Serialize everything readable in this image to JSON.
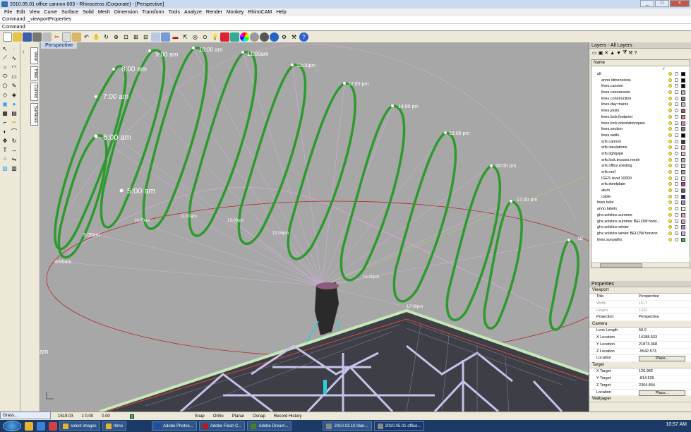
{
  "window": {
    "title": "2010.05.01 office cannon 003 - Rhinoceros (Corporate) - [Perspective]",
    "minimize": "_",
    "maximize": "□",
    "close": "×"
  },
  "menu": [
    "File",
    "Edit",
    "View",
    "Curve",
    "Surface",
    "Solid",
    "Mesh",
    "Dimension",
    "Transform",
    "Tools",
    "Analyze",
    "Render",
    "Monkey",
    "RhinoCAM",
    "Help"
  ],
  "command": {
    "history": "Command: _viewportProperties",
    "prompt": "Command:"
  },
  "viewport": {
    "label": "Perspective"
  },
  "side_tabs": [
    "View",
    "Files",
    "Curves",
    "Surfaces"
  ],
  "sun_labels": [
    "5:00 am",
    "6:00 am",
    "7:00 am",
    "8:00 am",
    "9:00 am",
    "10:00 am",
    "11:00am",
    "12:00pm",
    "12:00 pm",
    "14:00 pm",
    "15:00 pm",
    "16:00 pm",
    "17:00 pm",
    "18",
    "5:00am",
    "6:00am",
    "10:00am",
    "11:00am",
    "12:00pm",
    "13:00pm",
    "16:00pm",
    "17:00pm",
    "am"
  ],
  "layers": {
    "title": "Layers - All Layers",
    "column": "Name",
    "check": "✓",
    "rows": [
      {
        "name": "all",
        "depth": 0,
        "color": "#000000"
      },
      {
        "name": "anno.dimensions",
        "depth": 2,
        "color": "#000000"
      },
      {
        "name": "lines.cannon",
        "depth": 2,
        "color": "#000000"
      },
      {
        "name": "lines.cannonaxis",
        "depth": 2,
        "color": "#9cc39c"
      },
      {
        "name": "lines.construction",
        "depth": 2,
        "color": "#7f7f7f"
      },
      {
        "name": "lines.day marks",
        "depth": 2,
        "color": "#c0c0c0"
      },
      {
        "name": "lines.joists",
        "depth": 2,
        "color": "#a05a5a"
      },
      {
        "name": "lines.lock.footprint",
        "depth": 2,
        "color": "#e08080"
      },
      {
        "name": "lines.lock.orientationques",
        "depth": 2,
        "color": "#d87ad8"
      },
      {
        "name": "lines.section",
        "depth": 2,
        "color": "#808080"
      },
      {
        "name": "lines.walls",
        "depth": 2,
        "color": "#000000"
      },
      {
        "name": "srfs.cannon",
        "depth": 2,
        "color": "#404040"
      },
      {
        "name": "srfs.insulations",
        "depth": 2,
        "color": "#f0a0a0"
      },
      {
        "name": "srfs.lightpipe",
        "depth": 2,
        "color": "#ffc0c0"
      },
      {
        "name": "srfs.lock.trusses.mesh",
        "depth": 2,
        "color": "#c0b0d0"
      },
      {
        "name": "srfs.office.existing",
        "depth": 2,
        "color": "#c8c8c8"
      },
      {
        "name": "srfs.roof",
        "depth": 2,
        "color": "#b0b0b0"
      },
      {
        "name": "IGES level 10000",
        "depth": 2,
        "color": "#e0e0e0"
      },
      {
        "name": "srfs.steelplate",
        "depth": 2,
        "color": "#e020c0"
      },
      {
        "name": "alum",
        "depth": 2,
        "color": "#606060"
      },
      {
        "name": "cable",
        "depth": 2,
        "color": "#2020c0"
      },
      {
        "name": "lines.tube",
        "depth": 0,
        "color": "#9090d0"
      },
      {
        "name": "anno.labels",
        "depth": 0,
        "color": "#ffffff"
      },
      {
        "name": "ghx.solstice.summer",
        "depth": 0,
        "color": "#ffa0c0"
      },
      {
        "name": "ghx.solstice.summer BELOW.horiz...",
        "depth": 0,
        "color": "#e0a0e0"
      },
      {
        "name": "ghx.solstice.winter",
        "depth": 0,
        "color": "#c080ff"
      },
      {
        "name": "ghx.solstice.winter BELOW.horizon",
        "depth": 0,
        "color": "#d0b0ff"
      },
      {
        "name": "lines.sunpaths",
        "depth": 0,
        "color": "#30c030"
      }
    ]
  },
  "properties": {
    "title": "Properties",
    "sections": [
      {
        "name": "Viewport",
        "rows": [
          {
            "key": "Title",
            "value": "Perspective"
          },
          {
            "key": "Width",
            "value": "1517",
            "disabled": true
          },
          {
            "key": "Height",
            "value": "1032",
            "disabled": true
          },
          {
            "key": "Projection",
            "value": "Perspective"
          }
        ]
      },
      {
        "name": "Camera",
        "rows": [
          {
            "key": "Lens Length",
            "value": "50.0"
          },
          {
            "key": "X Location",
            "value": "14188.533"
          },
          {
            "key": "Y Location",
            "value": "21873.468"
          },
          {
            "key": "Z Location",
            "value": "-5542.573"
          },
          {
            "key": "Location",
            "value": "Place...",
            "button": true
          }
        ]
      },
      {
        "name": "Target",
        "rows": [
          {
            "key": "X Target",
            "value": "120.982"
          },
          {
            "key": "Y Target",
            "value": "-814.526"
          },
          {
            "key": "Z Target",
            "value": "2364.854"
          },
          {
            "key": "Location",
            "value": "Place...",
            "button": true
          }
        ]
      },
      {
        "name": "Wallpaper",
        "rows": []
      }
    ]
  },
  "status": {
    "coord_x": "1519.03",
    "coord_y": "z 0.00",
    "coord_z": "0.00",
    "snap": "Snap",
    "ortho": "Ortho",
    "planar": "Planar",
    "osnap": "Osnap",
    "record": "Record History"
  },
  "grasshopper": {
    "label": "Grass..."
  },
  "taskbar": {
    "items": [
      "select images",
      "rhino",
      "Adobe Photos...",
      "Adobe Flash C...",
      "Adobe Dream...",
      "2010.03.10 blan...",
      "2010.05.01 office..."
    ],
    "clock": "10:57 AM"
  }
}
